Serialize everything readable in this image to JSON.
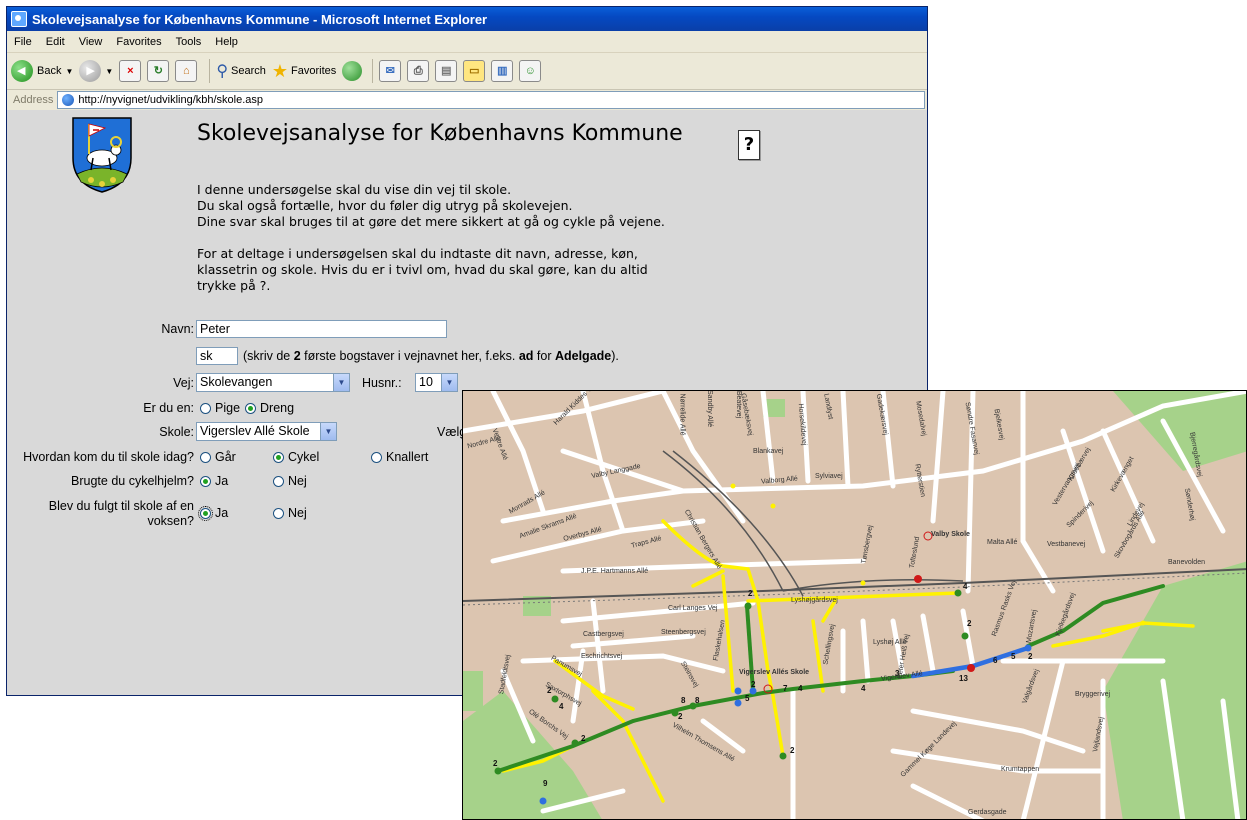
{
  "window": {
    "title": "Skolevejsanalyse for Københavns Kommune - Microsoft Internet Explorer",
    "menu": [
      "File",
      "Edit",
      "View",
      "Favorites",
      "Tools",
      "Help"
    ],
    "toolbar": {
      "back": "Back",
      "search": "Search",
      "favorites": "Favorites"
    },
    "address_label": "Address",
    "address_url": "http://nyvignet/udvikling/kbh/skole.asp"
  },
  "page": {
    "title": "Skolevejsanalyse for Københavns Kommune",
    "help": "?",
    "intro1": "I denne undersøgelse skal du vise din vej til skole.",
    "intro2": "Du skal også fortælle, hvor du føler dig utryg på skolevejen.",
    "intro3": "Dine svar skal bruges til at gøre det mere sikkert at gå og cykle på vejene.",
    "intro4a": "For at deltage i undersøgelsen skal du indtaste dit navn, adresse, køn,",
    "intro4b": "klassetrin og skole. Hvis du er i tvivl om, hvad du skal gøre, kan du altid",
    "intro4c": "trykke på ?."
  },
  "form": {
    "name_label": "Navn:",
    "name_value": "Peter",
    "street_prefix_value": "sk",
    "hint_pre": "(skriv de ",
    "hint_num": "2",
    "hint_mid": " første bogstaver i vejnavnet her, f.eks. ",
    "hint_ex": "ad",
    "hint_for": " for ",
    "hint_street": "Adelgade",
    "hint_end": ").",
    "street_label": "Vej:",
    "street_value": "Skolevangen",
    "house_label": "Husnr.:",
    "house_value": "10",
    "gender_label": "Er du en:",
    "gender_girl": "Pige",
    "gender_boy": "Dreng",
    "school_label": "Skole:",
    "school_value": "Vigerslev Allé Skole",
    "choose_label": "Vælg",
    "transport_label": "Hvordan kom du til skole idag?",
    "transport_walk": "Går",
    "transport_bike": "Cykel",
    "transport_moped": "Knallert",
    "helmet_label": "Brugte du cykelhjelm?",
    "accompanied_label1": "Blev du fulgt til skole af en",
    "accompanied_label2": "voksen?",
    "yes": "Ja",
    "no": "Nej"
  },
  "map": {
    "streets": [
      "Nordre Allé",
      "Harald Kiddes Vej",
      "Nørrelide Allé",
      "Vestre Allé",
      "Sandby Allé",
      "Beatevej",
      "Gåsebæksvej",
      "Horsekildevej",
      "Landlyst",
      "Gadekærsvej",
      "Mosedalvej",
      "Søndre Fasanvej",
      "Bjelkesvej",
      "Blankavej",
      "Valby Langgade",
      "Valborg Allé",
      "Sylviavej",
      "Rytterstien",
      "Vestervangsvej",
      "Kirsebærvej",
      "Kirkevænget",
      "Spinderivej",
      "Lindevej",
      "Skovbogårds Allé",
      "Bjerregårdsvej",
      "Sønderhøj",
      "Monrads Allé",
      "Amalie Skrams Allé",
      "Overbys Allé",
      "Traps Allé",
      "Christian Bergers Allé",
      "Valby Skole",
      "Tofteslund",
      "Malta Allé",
      "Vestbanevej",
      "Banevolden",
      "Tønsbergvej",
      "J.P.E. Hartmanns Allé",
      "Carl Langes Vej",
      "Lyshøjgårdsvej",
      "Castbergsvej",
      "Steenbergsvej",
      "Lyshøj Allé",
      "Eschrichtsvej",
      "Flaskehalsen",
      "Peter Heiß Vej",
      "Schellingsvej",
      "Rasmus Rasks Vej",
      "Mozartsvej",
      "Kjelkegårdsvej",
      "Panumsvej",
      "Steinsvej",
      "Vigerslev Allés Skole",
      "Vigerslev Allé",
      "Saxtorphsvej",
      "Olé Borchs Vej",
      "Vilhelm Thomsens Allé",
      "Valgårdsvej",
      "Bryggerivej",
      "Vejlandsvej",
      "Krumtappen",
      "Gammel Køge Landevej",
      "Stadfeldtsvej",
      "Gerdasgade"
    ],
    "stop_counts": [
      "2",
      "2",
      "8",
      "8",
      "5",
      "7",
      "4",
      "2",
      "4",
      "4",
      "3",
      "13",
      "6",
      "5",
      "2",
      "2",
      "4",
      "2",
      "9",
      "2",
      "2",
      "2"
    ]
  }
}
